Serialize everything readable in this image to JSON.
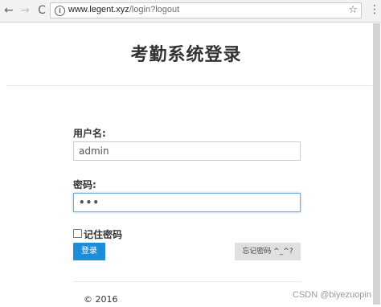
{
  "browser": {
    "url_host": "www.legent.xyz",
    "url_path": "/login?logout",
    "back_glyph": "←",
    "forward_glyph": "→",
    "reload_glyph": "C",
    "info_glyph": "i",
    "star_glyph": "☆",
    "menu_glyph": "⋮"
  },
  "page": {
    "title": "考勤系统登录"
  },
  "form": {
    "username_label": "用户名:",
    "username_value": "admin",
    "password_label": "密码:",
    "password_value": "•••",
    "remember_label": "记住密码",
    "login_label": "登录",
    "forgot_label": "忘记密码 ^_^?"
  },
  "footer": {
    "copyright": "© 2016",
    "watermark": "CSDN @biyezuopin"
  }
}
